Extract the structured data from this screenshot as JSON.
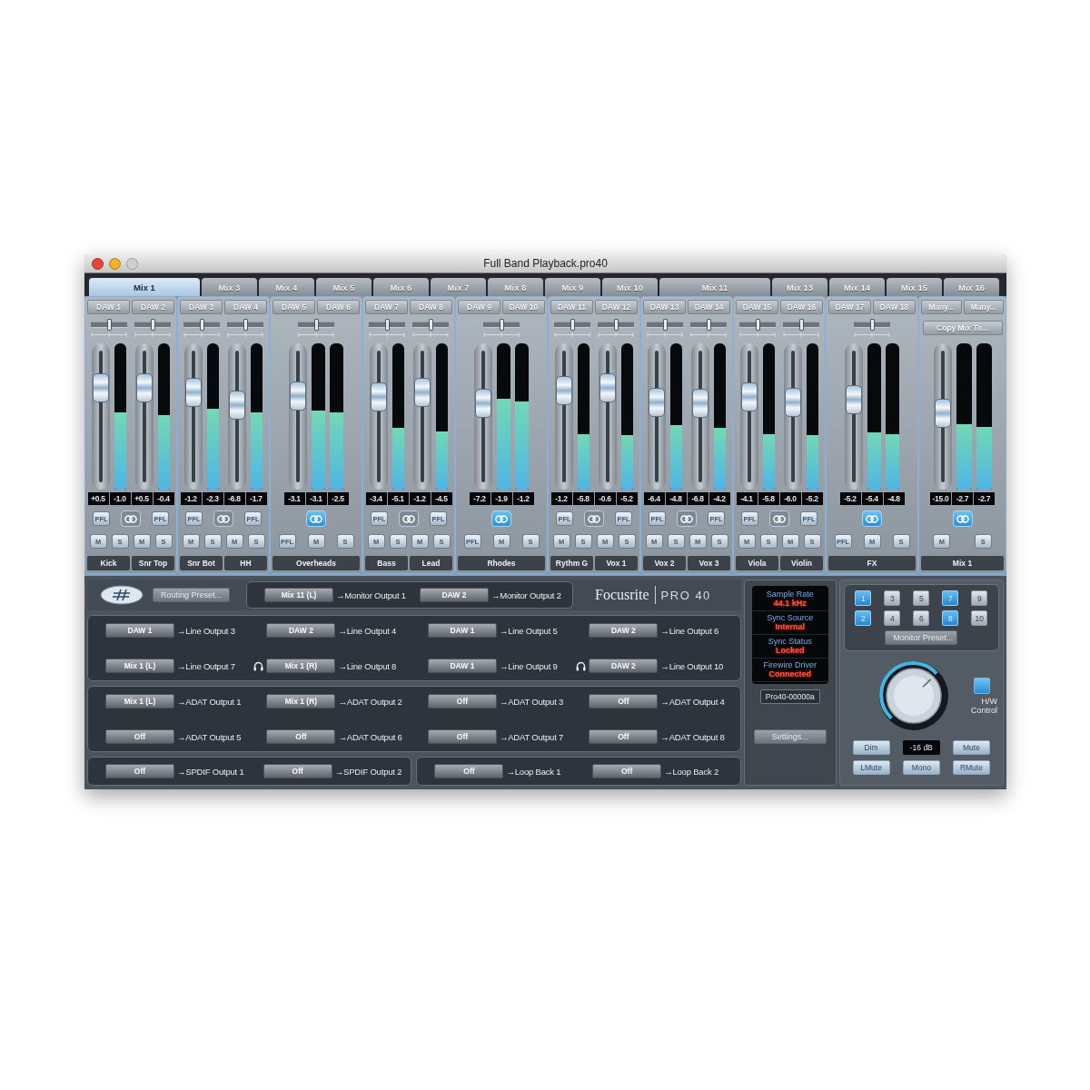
{
  "window": {
    "title": "Full Band Playback.pro40"
  },
  "tabs": [
    {
      "label": "Mix 1",
      "kind": "stereo",
      "selected": true
    },
    {
      "label": "Mix 3",
      "kind": "mono",
      "selected": false
    },
    {
      "label": "Mix 4",
      "kind": "mono",
      "selected": false
    },
    {
      "label": "Mix 5",
      "kind": "mono",
      "selected": false
    },
    {
      "label": "Mix 6",
      "kind": "mono",
      "selected": false
    },
    {
      "label": "Mix 7",
      "kind": "mono",
      "selected": false
    },
    {
      "label": "Mix 8",
      "kind": "mono",
      "selected": false
    },
    {
      "label": "Mix 9",
      "kind": "mono",
      "selected": false
    },
    {
      "label": "Mix 10",
      "kind": "mono",
      "selected": false
    },
    {
      "label": "Mix 11",
      "kind": "stereo",
      "selected": false
    },
    {
      "label": "Mix 13",
      "kind": "mono",
      "selected": false
    },
    {
      "label": "Mix 14",
      "kind": "mono",
      "selected": false
    },
    {
      "label": "Mix 15",
      "kind": "mono",
      "selected": false
    },
    {
      "label": "Mix 16",
      "kind": "mono",
      "selected": false
    }
  ],
  "mixer": {
    "groups": [
      {
        "kind": "pair",
        "linked": false,
        "channels": [
          {
            "input": "DAW 1",
            "name": "Kick",
            "pan": {
              "level": 0.5
            },
            "fader": {
              "level": 0.75
            },
            "meters": [
              {
                "level": 0.53
              }
            ],
            "readings": [
              "+0.5",
              "-1.0"
            ],
            "pfl": "PFL",
            "mute": "M",
            "solo": "S"
          },
          {
            "input": "DAW 2",
            "name": "Snr Top",
            "pan": {
              "level": 0.5
            },
            "fader": {
              "level": 0.75
            },
            "meters": [
              {
                "level": 0.51
              }
            ],
            "readings": [
              "+0.5",
              "-0.4"
            ],
            "pfl": "PFL",
            "mute": "M",
            "solo": "S"
          }
        ]
      },
      {
        "kind": "pair",
        "linked": false,
        "channels": [
          {
            "input": "DAW 3",
            "name": "Snr Bot",
            "pan": {
              "level": 0.5
            },
            "fader": {
              "level": 0.71
            },
            "meters": [
              {
                "level": 0.55
              }
            ],
            "readings": [
              "-1.2",
              "-2.3"
            ],
            "pfl": "PFL",
            "mute": "M",
            "solo": "S"
          },
          {
            "input": "DAW 4",
            "name": "HH",
            "pan": {
              "level": 0.5
            },
            "fader": {
              "level": 0.6
            },
            "meters": [
              {
                "level": 0.53
              }
            ],
            "readings": [
              "-6.8",
              "-1.7"
            ],
            "pfl": "PFL",
            "mute": "M",
            "solo": "S"
          }
        ]
      },
      {
        "kind": "stereo",
        "linked": true,
        "inputs": [
          "DAW 5",
          "DAW 6"
        ],
        "name": "Overheads",
        "pan": {
          "level": 0.5
        },
        "fader": {
          "level": 0.68
        },
        "meters": [
          {
            "level": 0.54
          },
          {
            "level": 0.53
          }
        ],
        "readings": [
          "-3.1",
          "-3.1",
          "-2.5"
        ],
        "pfl": "PFL",
        "mute": "M",
        "solo": "S"
      },
      {
        "kind": "pair",
        "linked": false,
        "channels": [
          {
            "input": "DAW 7",
            "name": "Bass",
            "pan": {
              "level": 0.5
            },
            "fader": {
              "level": 0.67
            },
            "meters": [
              {
                "level": 0.42
              }
            ],
            "readings": [
              "-3.4",
              "-5.1"
            ],
            "pfl": "PFL",
            "mute": "M",
            "solo": "S"
          },
          {
            "input": "DAW 8",
            "name": "Lead",
            "pan": {
              "level": 0.5
            },
            "fader": {
              "level": 0.71
            },
            "meters": [
              {
                "level": 0.4
              }
            ],
            "readings": [
              "-1.2",
              "-4.5"
            ],
            "pfl": "PFL",
            "mute": "M",
            "solo": "S"
          }
        ]
      },
      {
        "kind": "stereo",
        "linked": true,
        "inputs": [
          "DAW 9",
          "DAW 10"
        ],
        "name": "Rhodes",
        "pan": {
          "level": 0.5
        },
        "fader": {
          "level": 0.62
        },
        "meters": [
          {
            "level": 0.62
          },
          {
            "level": 0.6
          }
        ],
        "readings": [
          "-7.2",
          "-1.9",
          "-1.2"
        ],
        "pfl": "PFL",
        "mute": "M",
        "solo": "S"
      },
      {
        "kind": "pair",
        "linked": false,
        "channels": [
          {
            "input": "DAW 11",
            "name": "Rythm G",
            "pan": {
              "level": 0.5
            },
            "fader": {
              "level": 0.73
            },
            "meters": [
              {
                "level": 0.38
              }
            ],
            "readings": [
              "-1.2",
              "-5.8"
            ],
            "pfl": "PFL",
            "mute": "M",
            "solo": "S"
          },
          {
            "input": "DAW 12",
            "name": "Vox 1",
            "pan": {
              "level": 0.5
            },
            "fader": {
              "level": 0.75
            },
            "meters": [
              {
                "level": 0.37
              }
            ],
            "readings": [
              "-0.6",
              "-5.2"
            ],
            "pfl": "PFL",
            "mute": "M",
            "solo": "S"
          }
        ]
      },
      {
        "kind": "pair",
        "linked": false,
        "channels": [
          {
            "input": "DAW 13",
            "name": "Vox 2",
            "pan": {
              "level": 0.5
            },
            "fader": {
              "level": 0.63
            },
            "meters": [
              {
                "level": 0.44
              }
            ],
            "readings": [
              "-6.4",
              "-4.8"
            ],
            "pfl": "PFL",
            "mute": "M",
            "solo": "S"
          },
          {
            "input": "DAW 14",
            "name": "Vox 3",
            "pan": {
              "level": 0.5
            },
            "fader": {
              "level": 0.62
            },
            "meters": [
              {
                "level": 0.42
              }
            ],
            "readings": [
              "-6.8",
              "-4.2"
            ],
            "pfl": "PFL",
            "mute": "M",
            "solo": "S"
          }
        ]
      },
      {
        "kind": "pair",
        "linked": false,
        "channels": [
          {
            "input": "DAW 15",
            "name": "Viola",
            "pan": {
              "level": 0.5
            },
            "fader": {
              "level": 0.67
            },
            "meters": [
              {
                "level": 0.38
              }
            ],
            "readings": [
              "-4.1",
              "-5.8"
            ],
            "pfl": "PFL",
            "mute": "M",
            "solo": "S"
          },
          {
            "input": "DAW 16",
            "name": "Violin",
            "pan": {
              "level": 0.5
            },
            "fader": {
              "level": 0.63
            },
            "meters": [
              {
                "level": 0.37
              }
            ],
            "readings": [
              "-6.0",
              "-5.2"
            ],
            "pfl": "PFL",
            "mute": "M",
            "solo": "S"
          }
        ]
      },
      {
        "kind": "stereo",
        "linked": true,
        "inputs": [
          "DAW 17",
          "DAW 18"
        ],
        "name": "FX",
        "pan": {
          "level": 0.5
        },
        "fader": {
          "level": 0.65
        },
        "meters": [
          {
            "level": 0.39
          },
          {
            "level": 0.38
          }
        ],
        "readings": [
          "-5.2",
          "-5.4",
          "-4.8"
        ],
        "pfl": "PFL",
        "mute": "M",
        "solo": "S"
      },
      {
        "kind": "master",
        "linked": true,
        "inputs": [
          "Many...",
          "Many..."
        ],
        "copy_button": "Copy Mix To...",
        "name": "Mix 1",
        "fader": {
          "level": 0.53
        },
        "meters": [
          {
            "level": 0.45
          },
          {
            "level": 0.43
          }
        ],
        "readings": [
          "-15.0",
          "-2.7",
          "-2.7"
        ],
        "mute": "M",
        "solo": "S"
      }
    ]
  },
  "routing": {
    "preset_button": "Routing Preset...",
    "logo": {
      "brand": "Focusrite",
      "model": "PRO 40"
    },
    "boxes": [
      {
        "kind": "monitor",
        "routes": [
          {
            "source": "Mix 11 (L)",
            "dest": "→Monitor Output 1",
            "headphones": false
          },
          {
            "source": "DAW 2",
            "dest": "→Monitor Output 2",
            "headphones": false
          }
        ]
      },
      {
        "kind": "full",
        "routes": [
          {
            "source": "DAW 1",
            "dest": "→Line Output 3",
            "headphones": false
          },
          {
            "source": "DAW 2",
            "dest": "→Line Output 4",
            "headphones": false
          },
          {
            "source": "DAW 1",
            "dest": "→Line Output 5",
            "headphones": false
          },
          {
            "source": "DAW 2",
            "dest": "→Line Output 6",
            "headphones": false
          },
          {
            "source": "Mix 1 (L)",
            "dest": "→Line Output 7",
            "headphones": false
          },
          {
            "source": "Mix 1 (R)",
            "dest": "→Line Output 8",
            "headphones": true
          },
          {
            "source": "DAW 1",
            "dest": "→Line Output 9",
            "headphones": false
          },
          {
            "source": "DAW 2",
            "dest": "→Line Output 10",
            "headphones": true
          }
        ]
      },
      {
        "kind": "full",
        "routes": [
          {
            "source": "Mix 1 (L)",
            "dest": "→ADAT Output 1",
            "headphones": false
          },
          {
            "source": "Mix 1 (R)",
            "dest": "→ADAT Output 2",
            "headphones": false
          },
          {
            "source": "Off",
            "dest": "→ADAT Output 3",
            "headphones": false
          },
          {
            "source": "Off",
            "dest": "→ADAT Output 4",
            "headphones": false
          },
          {
            "source": "Off",
            "dest": "→ADAT Output 5",
            "headphones": false
          },
          {
            "source": "Off",
            "dest": "→ADAT Output 6",
            "headphones": false
          },
          {
            "source": "Off",
            "dest": "→ADAT Output 7",
            "headphones": false
          },
          {
            "source": "Off",
            "dest": "→ADAT Output 8",
            "headphones": false
          }
        ]
      },
      {
        "kind": "half",
        "routes": [
          {
            "source": "Off",
            "dest": "→SPDIF Output 1",
            "headphones": false
          },
          {
            "source": "Off",
            "dest": "→SPDIF Output 2",
            "headphones": false
          }
        ]
      },
      {
        "kind": "half",
        "routes": [
          {
            "source": "Off",
            "dest": "→Loop Back 1",
            "headphones": false
          },
          {
            "source": "Off",
            "dest": "→Loop Back 2",
            "headphones": false
          }
        ]
      }
    ]
  },
  "status": {
    "items": [
      {
        "label": "Sample Rate",
        "value": "44.1 kHz"
      },
      {
        "label": "Sync Source",
        "value": "Internal"
      },
      {
        "label": "Sync Status",
        "value": "Locked"
      },
      {
        "label": "Firewire Driver",
        "value": "Connected"
      }
    ],
    "device": "Pro40-00000a",
    "settings_button": "Settings..."
  },
  "monitor": {
    "speakers": [
      {
        "label": "1",
        "selected": true
      },
      {
        "label": "3",
        "selected": false
      },
      {
        "label": "5",
        "selected": false
      },
      {
        "label": "7",
        "selected": true
      },
      {
        "label": "9",
        "selected": false
      },
      {
        "label": "2",
        "selected": true
      },
      {
        "label": "4",
        "selected": false
      },
      {
        "label": "6",
        "selected": false
      },
      {
        "label": "8",
        "selected": true
      },
      {
        "label": "10",
        "selected": false
      }
    ],
    "preset_button": "Monitor Preset...",
    "volume": "-16 dB",
    "hw_control": {
      "label": "H/W Control",
      "on": true
    },
    "buttons": [
      {
        "label": "Dim",
        "on": false
      },
      {
        "label": "Mute",
        "on": false
      },
      {
        "label": "LMute",
        "on": false
      },
      {
        "label": "Mono",
        "on": false
      },
      {
        "label": "RMute",
        "on": false
      }
    ]
  }
}
